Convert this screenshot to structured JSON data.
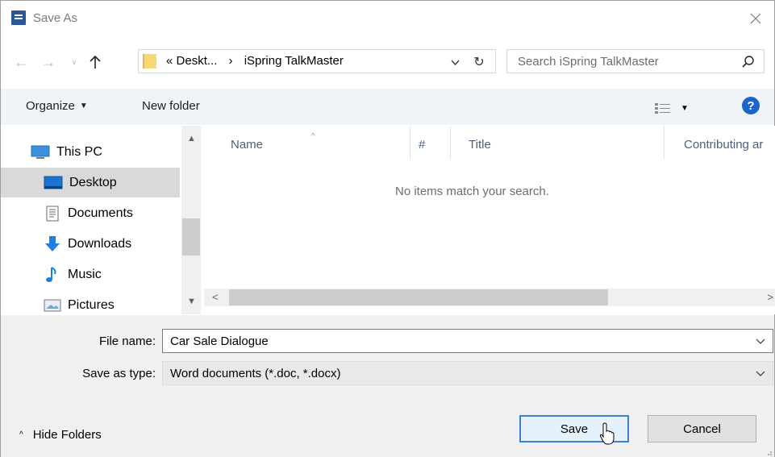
{
  "window": {
    "title": "Save As"
  },
  "address": {
    "crumbs": [
      "«",
      "Deskt...",
      "›",
      "iSpring TalkMaster"
    ]
  },
  "search": {
    "placeholder": "Search iSpring TalkMaster"
  },
  "toolbar": {
    "organize_label": "Organize",
    "new_folder_label": "New folder",
    "help_label": "?"
  },
  "nav": {
    "items": [
      {
        "label": "This PC",
        "icon": "computer-icon"
      },
      {
        "label": "Desktop",
        "icon": "desktop-icon",
        "selected": true
      },
      {
        "label": "Documents",
        "icon": "documents-icon"
      },
      {
        "label": "Downloads",
        "icon": "downloads-icon"
      },
      {
        "label": "Music",
        "icon": "music-icon"
      },
      {
        "label": "Pictures",
        "icon": "pictures-icon"
      }
    ]
  },
  "list": {
    "columns": [
      "Name",
      "#",
      "Title",
      "Contributing ar"
    ],
    "empty_message": "No items match your search."
  },
  "form": {
    "file_name_label": "File name:",
    "file_name_value": "Car Sale Dialogue",
    "save_type_label": "Save as type:",
    "save_type_value": "Word documents (*.doc, *.docx)"
  },
  "footer": {
    "hide_folders_label": "Hide Folders",
    "save_label": "Save",
    "cancel_label": "Cancel"
  },
  "colors": {
    "accent": "#3c82d6",
    "help": "#1a65c7",
    "toolbar_bg": "#f0f4f9",
    "selected_bg": "#d9d9d9"
  }
}
